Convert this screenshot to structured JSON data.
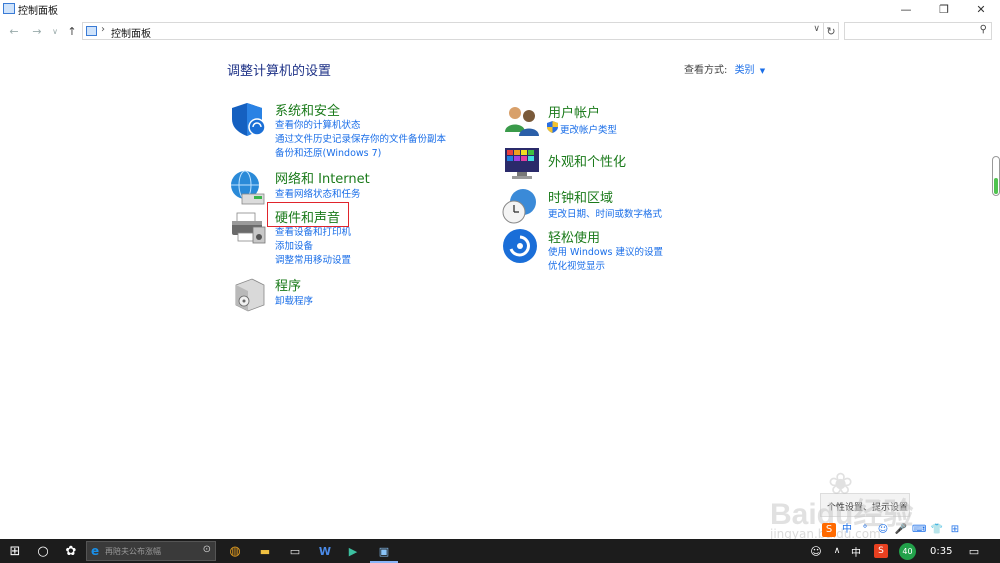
{
  "window": {
    "title": "控制面板",
    "minimize_symbol": "—",
    "restore_symbol": "❐",
    "close_symbol": "✕"
  },
  "nav": {
    "back_symbol": "←",
    "forward_symbol": "→",
    "dropdown_symbol": "∨",
    "up_symbol": "↑",
    "breadcrumb_separator": "›",
    "breadcrumb": "控制面板",
    "address_dropdown_symbol": "∨",
    "refresh_symbol": "↻",
    "search_placeholder": "",
    "search_symbol": "⚲"
  },
  "main": {
    "title": "调整计算机的设置",
    "view_by_label": "查看方式:",
    "view_by_value": "类别",
    "view_by_caret": "▼"
  },
  "categories": {
    "system": {
      "heading": "系统和安全",
      "links": [
        "查看你的计算机状态",
        "通过文件历史记录保存你的文件备份副本",
        "备份和还原(Windows 7)"
      ]
    },
    "network": {
      "heading": "网络和 Internet",
      "links": [
        "查看网络状态和任务"
      ]
    },
    "hardware": {
      "heading": "硬件和声音",
      "links": [
        "查看设备和打印机",
        "添加设备",
        "调整常用移动设置"
      ]
    },
    "programs": {
      "heading": "程序",
      "links": [
        "卸载程序"
      ]
    },
    "user": {
      "heading": "用户帐户",
      "links": [
        "更改帐户类型"
      ]
    },
    "appearance": {
      "heading": "外观和个性化",
      "links": []
    },
    "clock": {
      "heading": "时钟和区域",
      "links": [
        "更改日期、时间或数字格式"
      ]
    },
    "ease": {
      "heading": "轻松使用",
      "links": [
        "使用 Windows 建议的设置",
        "优化视觉显示"
      ]
    }
  },
  "popup": {
    "text": "个性设置、提示设置"
  },
  "ime_toolbar": {
    "items": [
      "S",
      "中",
      "°",
      "☺",
      "🎤",
      "⌨",
      "👕",
      "⊞"
    ]
  },
  "watermark": {
    "logo": "Baidu经验",
    "sub": "jingyan.baidu.com"
  },
  "taskbar": {
    "search_placeholder": "再陪夫公布涨幅",
    "search_e": "e",
    "mic_symbol": "⊙",
    "start_symbol": "⊞",
    "cortana_symbol": "○",
    "taskview_symbol": "✿",
    "apps": [
      "◍",
      "▬",
      "▭",
      "W",
      "▶",
      "▣"
    ],
    "tray": {
      "people_symbol": "☺",
      "chevron": "∧",
      "ime_lang": "中",
      "sogou": "S",
      "battery": "40",
      "time": "0:35",
      "notification_symbol": "▭"
    }
  },
  "colors": {
    "category_heading": "#1a7a1a",
    "link": "#1a6ee8",
    "highlight_box": "#e0242c",
    "taskbar": "#1c1c1c"
  }
}
